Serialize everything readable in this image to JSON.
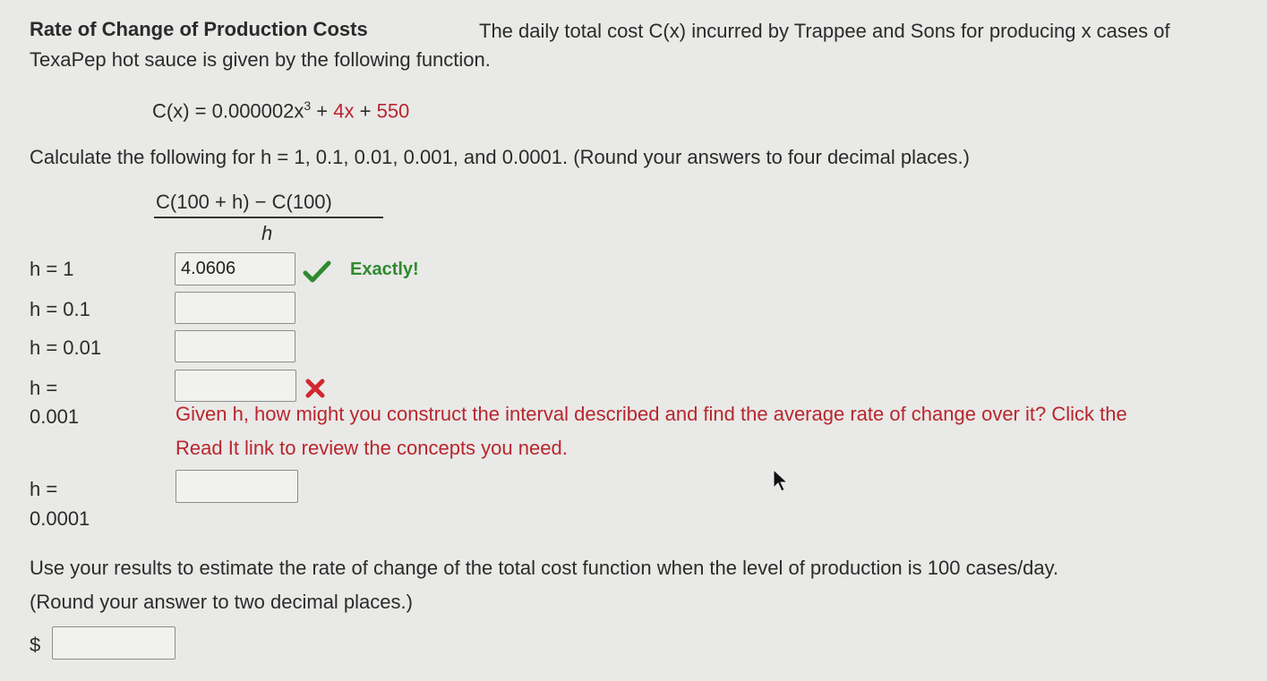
{
  "header": {
    "title": "Rate of Change of Production Costs",
    "intro_line1": "The daily total cost C(x) incurred by Trappee and Sons for producing x cases of",
    "intro_line2": "TexaPep hot sauce is given by the following function."
  },
  "function": {
    "lhs": "C(x) = 0.000002x",
    "exp": "3",
    "mid": " + ",
    "term2": "4x",
    "plus": " + ",
    "term3": "550"
  },
  "instruction": "Calculate the following for h = 1, 0.1, 0.01, 0.001, and 0.0001. (Round your answers to four decimal places.)",
  "fraction": {
    "numerator": "C(100 + h) − C(100)",
    "denominator": "h"
  },
  "rows": [
    {
      "label": "h = 1",
      "value": "4.0606",
      "status": "correct",
      "feedback": "Exactly!"
    },
    {
      "label": "h = 0.1",
      "value": "",
      "status": "none"
    },
    {
      "label": "h = 0.01",
      "value": "",
      "status": "none"
    },
    {
      "label_line1": "h =",
      "label_line2": "0.001",
      "value": "",
      "status": "incorrect",
      "hint_line1": "Given h, how might you construct the interval described and find the average rate of change over it? Click the",
      "hint_line2": "Read It link to review the concepts you need."
    },
    {
      "label_line1": "h =",
      "label_line2": "0.0001",
      "value": "",
      "status": "none"
    }
  ],
  "estimate": {
    "line1": "Use your results to estimate the rate of change of the total cost function when the level of production is 100 cases/day.",
    "line2": "(Round your answer to two decimal places.)",
    "currency": "$",
    "value": ""
  },
  "icons": {
    "correct": "checkmark-icon",
    "incorrect": "x-mark-icon",
    "cursor": "mouse-cursor-icon"
  },
  "colors": {
    "correct": "#2f8a2f",
    "incorrect": "#b8262d",
    "background": "#e9e9e7"
  }
}
